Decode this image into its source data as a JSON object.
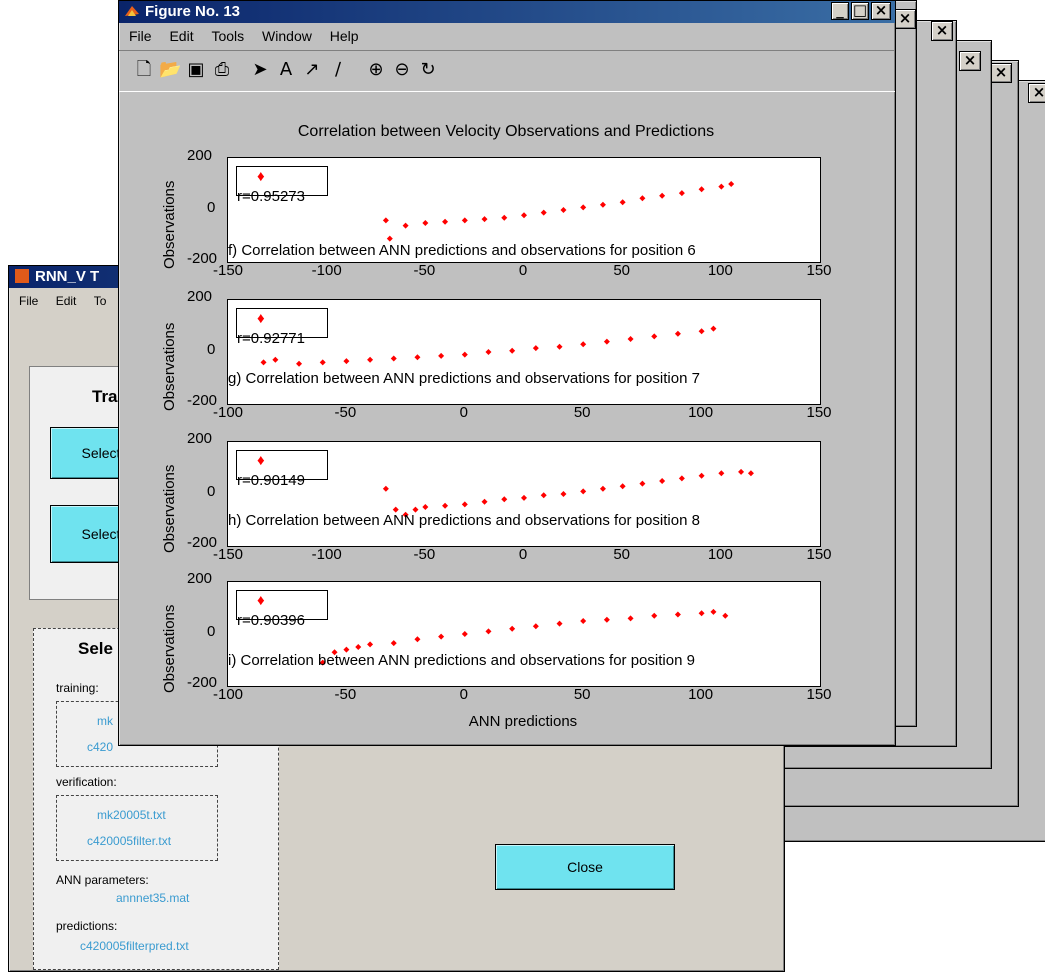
{
  "main_figure": {
    "title": "Figure No. 13",
    "menu": [
      "File",
      "Edit",
      "Tools",
      "Window",
      "Help"
    ],
    "toolbar_icons": [
      "new-file-icon",
      "open-folder-icon",
      "save-icon",
      "print-icon",
      "arrow-select-icon",
      "text-icon",
      "arrow-icon",
      "line-icon",
      "zoom-in-icon",
      "zoom-out-icon",
      "rotate-icon"
    ],
    "plot_title": "Correlation between Velocity Observations and Predictions",
    "xlabel": "ANN predictions",
    "ylabel": "Observations"
  },
  "rnn_window": {
    "title": "RNN_V T",
    "menu": [
      "File",
      "Edit",
      "To"
    ],
    "group1_title": "Tra",
    "select_button_1": "Select",
    "select_button_2": "Select",
    "group2_title": "Sele",
    "training_label": "training:",
    "training_files": [
      "mk",
      "c420"
    ],
    "verification_label": "verification:",
    "verification_files": [
      "mk20005t.txt",
      "c420005filter.txt"
    ],
    "ann_params_label": "ANN parameters:",
    "ann_params_file": "annnet35.mat",
    "predictions_label": "predictions:",
    "predictions_file": "c420005filterpred.txt",
    "close_button": "Close"
  },
  "colors": {
    "marker": "#ff0000",
    "titlebar": "#0a246a",
    "button": "#6fe3ef",
    "file_text": "#3a9bd0"
  },
  "chart_data": [
    {
      "type": "scatter",
      "legend": "r=0.95273",
      "annotation": "f) Correlation between ANN predictions and observations for position 6",
      "xlim": [
        -150,
        150
      ],
      "ylim": [
        -200,
        200
      ],
      "xticks": [
        "-150",
        "-100",
        "-50",
        "0",
        "50",
        "100",
        "150"
      ],
      "yticks": [
        "200",
        "0",
        "-200"
      ],
      "points": [
        [
          -70,
          -40
        ],
        [
          -68,
          -110
        ],
        [
          -60,
          -60
        ],
        [
          -50,
          -50
        ],
        [
          -40,
          -45
        ],
        [
          -30,
          -40
        ],
        [
          -20,
          -35
        ],
        [
          -10,
          -30
        ],
        [
          0,
          -20
        ],
        [
          10,
          -10
        ],
        [
          20,
          0
        ],
        [
          30,
          10
        ],
        [
          40,
          20
        ],
        [
          50,
          30
        ],
        [
          60,
          45
        ],
        [
          70,
          55
        ],
        [
          80,
          65
        ],
        [
          90,
          80
        ],
        [
          100,
          90
        ],
        [
          105,
          100
        ]
      ]
    },
    {
      "type": "scatter",
      "legend": "r=0.92771",
      "annotation": "g) Correlation between ANN predictions and observations for position 7",
      "xlim": [
        -100,
        150
      ],
      "ylim": [
        -200,
        200
      ],
      "xticks": [
        "-100",
        "-50",
        "0",
        "50",
        "100",
        "150"
      ],
      "yticks": [
        "200",
        "0",
        "-200"
      ],
      "points": [
        [
          -85,
          -40
        ],
        [
          -80,
          -30
        ],
        [
          -70,
          -45
        ],
        [
          -60,
          -40
        ],
        [
          -50,
          -35
        ],
        [
          -40,
          -30
        ],
        [
          -30,
          -25
        ],
        [
          -20,
          -20
        ],
        [
          -10,
          -15
        ],
        [
          0,
          -10
        ],
        [
          10,
          0
        ],
        [
          20,
          5
        ],
        [
          30,
          15
        ],
        [
          40,
          20
        ],
        [
          50,
          30
        ],
        [
          60,
          40
        ],
        [
          70,
          50
        ],
        [
          80,
          60
        ],
        [
          90,
          70
        ],
        [
          100,
          80
        ],
        [
          105,
          90
        ]
      ]
    },
    {
      "type": "scatter",
      "legend": "r=0.90149",
      "annotation": "h) Correlation between ANN predictions and observations for position 8",
      "xlim": [
        -150,
        150
      ],
      "ylim": [
        -200,
        200
      ],
      "xticks": [
        "-150",
        "-100",
        "-50",
        "0",
        "50",
        "100",
        "150"
      ],
      "yticks": [
        "200",
        "0",
        "-200"
      ],
      "points": [
        [
          -70,
          20
        ],
        [
          -65,
          -60
        ],
        [
          -60,
          -80
        ],
        [
          -55,
          -60
        ],
        [
          -50,
          -50
        ],
        [
          -40,
          -45
        ],
        [
          -30,
          -40
        ],
        [
          -20,
          -30
        ],
        [
          -10,
          -20
        ],
        [
          0,
          -15
        ],
        [
          10,
          -5
        ],
        [
          20,
          0
        ],
        [
          30,
          10
        ],
        [
          40,
          20
        ],
        [
          50,
          30
        ],
        [
          60,
          40
        ],
        [
          70,
          50
        ],
        [
          80,
          60
        ],
        [
          90,
          70
        ],
        [
          100,
          80
        ],
        [
          110,
          85
        ],
        [
          115,
          80
        ]
      ]
    },
    {
      "type": "scatter",
      "legend": "r=0.90396",
      "annotation": "i) Correlation between ANN predictions and observations for position 9",
      "xlim": [
        -100,
        150
      ],
      "ylim": [
        -200,
        200
      ],
      "xticks": [
        "-100",
        "-50",
        "0",
        "50",
        "100",
        "150"
      ],
      "yticks": [
        "200",
        "0",
        "-200"
      ],
      "points": [
        [
          -60,
          -110
        ],
        [
          -55,
          -70
        ],
        [
          -50,
          -60
        ],
        [
          -45,
          -50
        ],
        [
          -40,
          -40
        ],
        [
          -30,
          -35
        ],
        [
          -20,
          -20
        ],
        [
          -10,
          -10
        ],
        [
          0,
          0
        ],
        [
          10,
          10
        ],
        [
          20,
          20
        ],
        [
          30,
          30
        ],
        [
          40,
          40
        ],
        [
          50,
          50
        ],
        [
          60,
          55
        ],
        [
          70,
          60
        ],
        [
          80,
          70
        ],
        [
          90,
          75
        ],
        [
          100,
          80
        ],
        [
          105,
          85
        ],
        [
          110,
          70
        ]
      ]
    }
  ]
}
